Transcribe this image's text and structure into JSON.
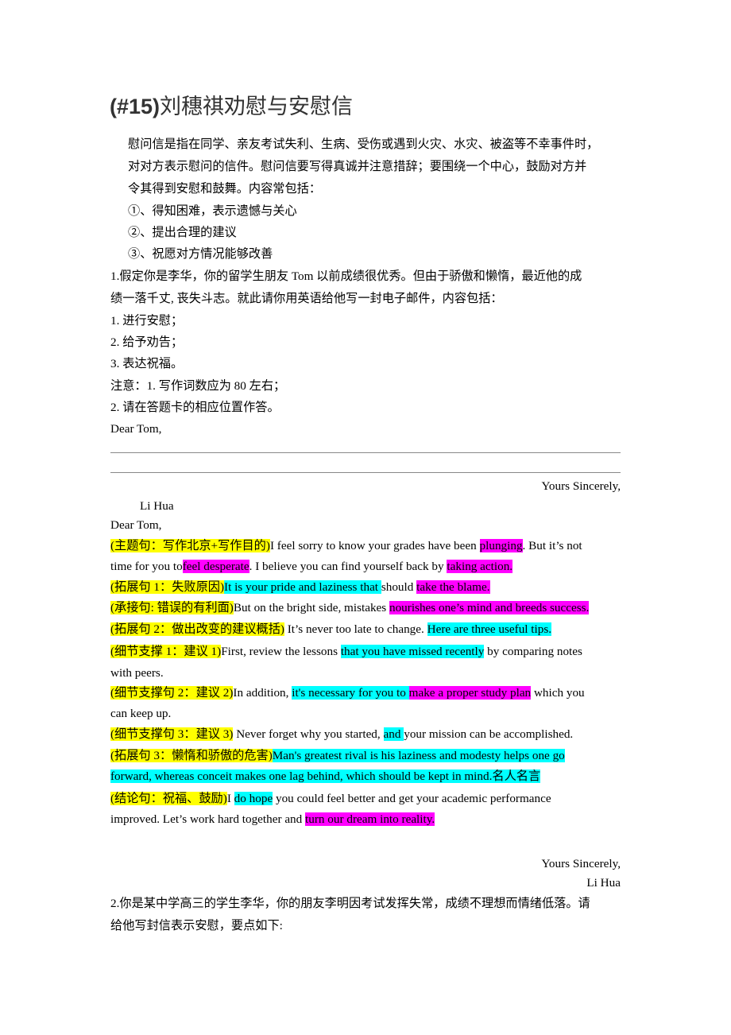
{
  "document": {
    "title_prefix": "(#15)",
    "title_main": "刘穗祺劝慰与安慰信",
    "intro": [
      "慰问信是指在同学、亲友考试失利、生病、受伤或遇到火灾、水灾、被盗等不幸事件时，",
      "对对方表示慰问的信件。慰问信要写得真诚并注意措辞；要围绕一个中心，鼓励对方并",
      "令其得到安慰和鼓舞。内容常包括："
    ],
    "intro_points": [
      "①、得知困难，表示遗憾与关心",
      "②、提出合理的建议",
      "③、祝愿对方情况能够改善"
    ],
    "task1": {
      "lines": [
        "1.假定你是李华，你的留学生朋友 Tom 以前成绩很优秀。但由于骄傲和懒惰，最近他的成",
        "绩一落千丈, 丧失斗志。就此请你用英语给他写一封电子邮件，内容包括：",
        "1. 进行安慰；",
        "2. 给予劝告；",
        "3. 表达祝福。",
        "注意：1. 写作词数应为 80 左右；",
        "2. 请在答题卡的相应位置作答。"
      ],
      "salutation": "Dear Tom,",
      "closing": "Yours Sincerely,",
      "signature": "Li Hua"
    },
    "sample": {
      "salutation": "Dear Tom,",
      "lines": [
        [
          {
            "t": "(主题句：写作北京+写作目的)",
            "h": "y"
          },
          {
            "t": "I feel sorry to know your grades have been ",
            "h": ""
          },
          {
            "t": "plunging",
            "h": "m"
          },
          {
            "t": ". But it’s not",
            "h": ""
          }
        ],
        [
          {
            "t": "time for you to",
            "h": ""
          },
          {
            "t": "feel desperate",
            "h": "m"
          },
          {
            "t": ". I believe you can find yourself back by ",
            "h": ""
          },
          {
            "t": "taking action.",
            "h": "m"
          }
        ],
        [
          {
            "t": "(拓展句 1：失败原因)",
            "h": "y"
          },
          {
            "t": "It is your pride and laziness that ",
            "h": "c"
          },
          {
            "t": "should ",
            "h": ""
          },
          {
            "t": "take the blame.",
            "h": "m"
          }
        ],
        [
          {
            "t": "(承接句: 错误的有利面)",
            "h": "y"
          },
          {
            "t": "But on the bright side, mistakes ",
            "h": ""
          },
          {
            "t": "nourishes one’s mind and breeds success.",
            "h": "m"
          }
        ],
        [
          {
            "t": "(拓展句 2：做出改变的建议概括)",
            "h": "y"
          },
          {
            "t": " It’s never too late to change. ",
            "h": ""
          },
          {
            "t": "Here are three useful tips.",
            "h": "c"
          }
        ],
        [
          {
            "t": "(细节支撑 1：建议 1)",
            "h": "y"
          },
          {
            "t": "First, review the lessons ",
            "h": ""
          },
          {
            "t": "that you have missed recently",
            "h": "c"
          },
          {
            "t": " by comparing notes",
            "h": ""
          }
        ],
        [
          {
            "t": "with peers.",
            "h": ""
          }
        ],
        [
          {
            "t": "(细节支撑句 2：建议 2)",
            "h": "y"
          },
          {
            "t": "In addition, ",
            "h": ""
          },
          {
            "t": "it's necessary for you to ",
            "h": "c"
          },
          {
            "t": "make a proper study plan",
            "h": "m"
          },
          {
            "t": " which you",
            "h": ""
          }
        ],
        [
          {
            "t": "can keep up.",
            "h": ""
          }
        ],
        [
          {
            "t": "(细节支撑句 3：建议 3)",
            "h": "y"
          },
          {
            "t": " Never forget why you started, ",
            "h": ""
          },
          {
            "t": "and ",
            "h": "c"
          },
          {
            "t": "your mission can be accomplished.",
            "h": ""
          }
        ],
        [
          {
            "t": "(拓展句 3：懒惰和骄傲的危害)",
            "h": "y"
          },
          {
            "t": "Man's greatest rival is his laziness and modesty helps one go",
            "h": "c"
          }
        ],
        [
          {
            "t": "forward, whereas conceit makes one lag behind, which should be kept in mind.名人名言",
            "h": "c"
          }
        ],
        [
          {
            "t": "(结论句：祝福、鼓励)",
            "h": "y"
          },
          {
            "t": "I ",
            "h": ""
          },
          {
            "t": "do hope",
            "h": "c"
          },
          {
            "t": " you could feel better and get your academic performance",
            "h": ""
          }
        ],
        [
          {
            "t": "improved. Let’s work hard together and ",
            "h": ""
          },
          {
            "t": "turn our dream into reality.",
            "h": "m"
          }
        ]
      ],
      "closing": "Yours Sincerely,",
      "signature": "Li Hua"
    },
    "task2": {
      "lines": [
        "2.你是某中学高三的学生李华，你的朋友李明因考试发挥失常，成绩不理想而情绪低落。请",
        "给他写封信表示安慰，要点如下:"
      ]
    }
  },
  "colors": {
    "highlight_yellow": "#ffff00",
    "highlight_cyan": "#00ffff",
    "highlight_magenta": "#ff00ff"
  }
}
